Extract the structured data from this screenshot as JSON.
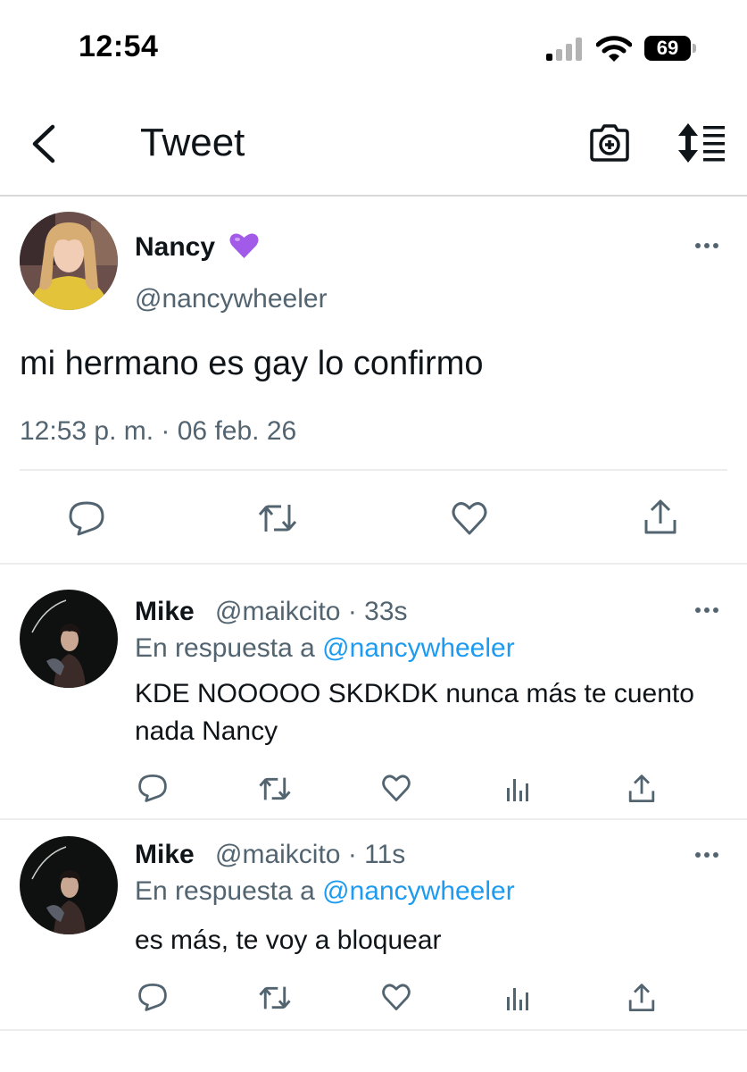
{
  "status_bar": {
    "time": "12:54",
    "battery": "69"
  },
  "header": {
    "title": "Tweet",
    "back_icon": "chevron-left-icon",
    "camera_icon": "camera-plus-icon",
    "sort_icon": "sort-lines-icon"
  },
  "tweet": {
    "name": "Nancy",
    "name_emoji": "purple-heart",
    "handle": "@nancywheeler",
    "text": "mi hermano es gay lo confirmo",
    "timestamp": "12:53 p. m. · 06 feb. 26",
    "actions": [
      "reply-icon",
      "retweet-icon",
      "like-icon",
      "share-icon"
    ]
  },
  "replies": [
    {
      "name": "Mike",
      "handle": "@maikcito",
      "time": "· 33s",
      "reply_prefix": "En respuesta a ",
      "reply_to": "@nancywheeler",
      "text": "KDE NOOOOO SKDKDK nunca más te cuento nada Nancy"
    },
    {
      "name": "Mike",
      "handle": "@maikcito",
      "time": "· 11s",
      "reply_prefix": "En respuesta a ",
      "reply_to": "@nancywheeler",
      "text": "es más, te voy a bloquear"
    }
  ],
  "colors": {
    "link": "#1d9bf0",
    "secondary_text": "#536471",
    "primary_text": "#0f1419",
    "emoji_heart": "#a25be8"
  }
}
